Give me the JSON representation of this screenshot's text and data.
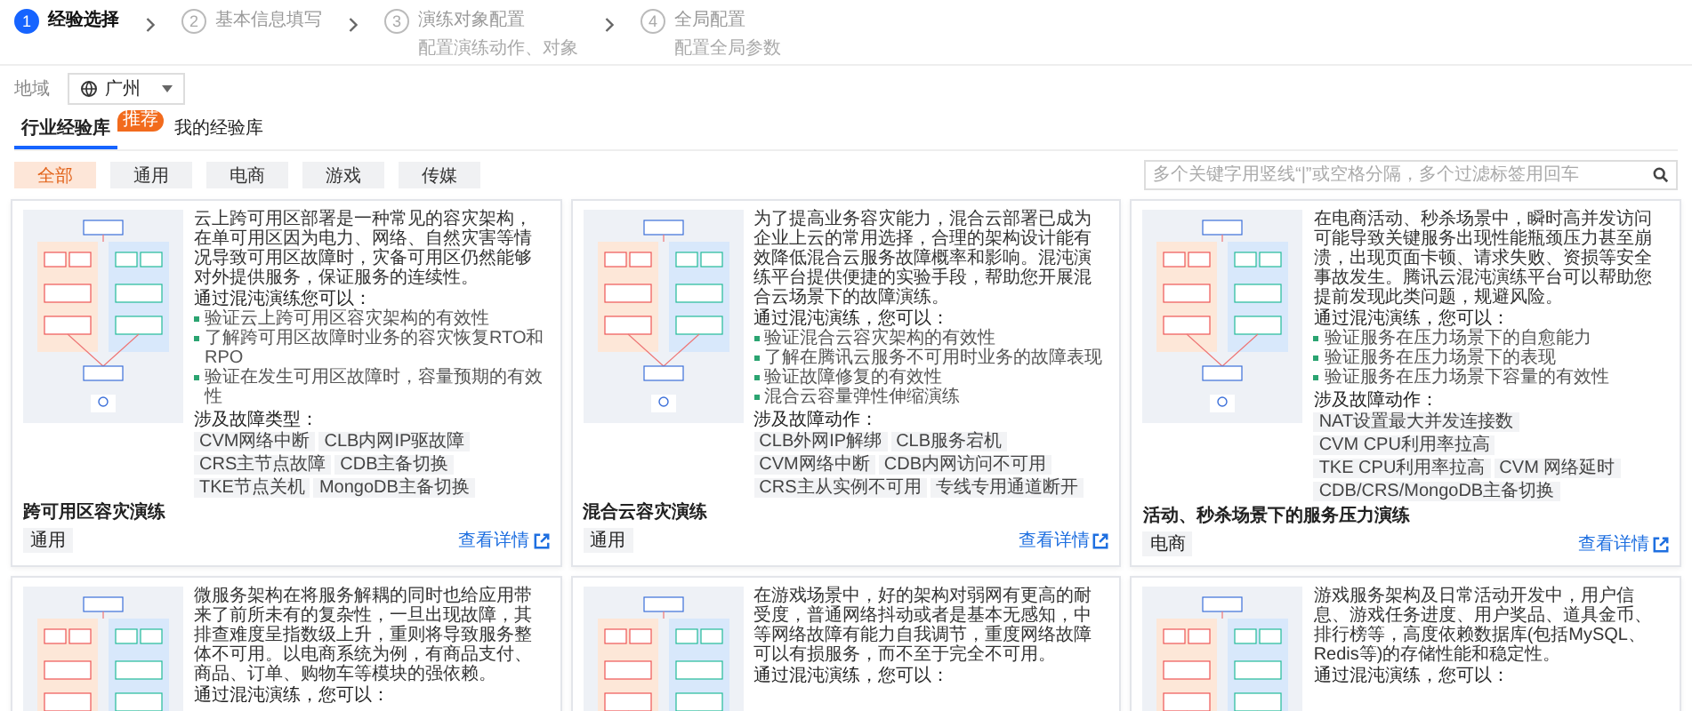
{
  "steps": [
    {
      "number": "1",
      "title": "经验选择",
      "selected": true
    },
    {
      "number": "2",
      "title": "基本信息填写",
      "selected": false
    },
    {
      "number": "3",
      "title": "演练对象配置",
      "subtitle": "配置演练动作、对象",
      "selected": false
    },
    {
      "number": "4",
      "title": "全局配置",
      "subtitle": "配置全局参数",
      "selected": false
    }
  ],
  "region": {
    "label": "地域",
    "value": "广州"
  },
  "library_tabs": [
    {
      "label": "行业经验库",
      "badge": "推荐",
      "selected": true
    },
    {
      "label": "我的经验库",
      "selected": false
    }
  ],
  "categories": [
    {
      "label": "全部",
      "selected": true
    },
    {
      "label": "通用",
      "selected": false
    },
    {
      "label": "电商",
      "selected": false
    },
    {
      "label": "游戏",
      "selected": false
    },
    {
      "label": "传媒",
      "selected": false
    }
  ],
  "search": {
    "placeholder": "多个关键字用竖线“|”或空格分隔，多个过滤标签用回车"
  },
  "cards": [
    {
      "title": "跨可用区容灾演练",
      "tag": "通用",
      "link": "查看详情",
      "description": "云上跨可用区部署是一种常见的容灾架构，在单可用区因为电力、网络、自然灾害等情况导致可用区故障时，灾备可用区仍然能够对外提供服务，保证服务的连续性。",
      "subheading": "通过混沌演练您可以：",
      "bullets": [
        "验证云上跨可用区容灾架构的有效性",
        "了解跨可用区故障时业务的容灾恢复RTO和RPO",
        "验证在发生可用区故障时，容量预期的有效性"
      ],
      "tags_heading": "涉及故障类型：",
      "fault_tags": [
        "CVM网络中断",
        "CLB内网IP驱故障",
        "CRS主节点故障",
        "CDB主备切换",
        "TKE节点关机",
        "MongoDB主备切换"
      ]
    },
    {
      "title": "混合云容灾演练",
      "tag": "通用",
      "link": "查看详情",
      "description": "为了提高业务容灾能力，混合云部署已成为企业上云的常用选择，合理的架构设计能有效降低混合云服务故障概率和影响。混沌演练平台提供便捷的实验手段，帮助您开展混合云场景下的故障演练。",
      "subheading": "通过混沌演练，您可以：",
      "bullets": [
        "验证混合云容灾架构的有效性",
        "了解在腾讯云服务不可用时业务的故障表现",
        "验证故障修复的有效性",
        "混合云容量弹性伸缩演练"
      ],
      "tags_heading": "涉及故障动作：",
      "fault_tags": [
        "CLB外网IP解绑",
        "CLB服务宕机",
        "CVM网络中断",
        "CDB内网访问不可用",
        "CRS主从实例不可用",
        "专线专用通道断开"
      ]
    },
    {
      "title": "活动、秒杀场景下的服务压力演练",
      "tag": "电商",
      "link": "查看详情",
      "description": "在电商活动、秒杀场景中，瞬时高并发访问可能导致关键服务出现性能瓶颈压力甚至崩溃，出现页面卡顿、请求失败、资损等安全事故发生。腾讯云混沌演练平台可以帮助您提前发现此类问题，规避风险。",
      "subheading": "通过混沌演练，您可以：",
      "bullets": [
        "验证服务在压力场景下的自愈能力",
        "验证服务在压力场景下的表现",
        "验证服务在压力场景下容量的有效性"
      ],
      "tags_heading": "涉及故障动作：",
      "fault_tags": [
        "NAT设置最大并发连接数",
        "CVM CPU利用率拉高",
        "TKE CPU利用率拉高",
        "CVM 网络延时",
        "CDB/CRS/MongoDB主备切换"
      ]
    },
    {
      "description": "微服务架构在将服务解耦的同时也给应用带来了前所未有的复杂性，一旦出现故障，其排查难度呈指数级上升，重则将导致服务整体不可用。以电商系统为例，有商品支付、商品、订单、购物车等模块的强依赖。",
      "subheading": "通过混沌演练，您可以："
    },
    {
      "description": "在游戏场景中，好的架构对弱网有更高的耐受度，普通网络抖动或者是基本无感知，中等网络故障有能力自我调节，重度网络故障可以有损服务，而不至于完全不可用。",
      "subheading": "通过混沌演练，您可以："
    },
    {
      "description": "游戏服务架构及日常活动开发中，用户信息、游戏任务进度、用户奖品、道具金币、排行榜等，高度依赖数据库(包括MySQL、Redis等)的存储性能和稳定性。",
      "subheading": "通过混沌演练，您可以："
    }
  ]
}
